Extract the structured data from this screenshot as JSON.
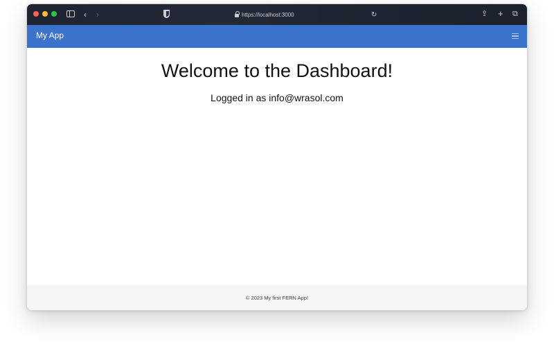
{
  "browser": {
    "url": "https://localhost:3000",
    "icons": [
      "sidebar-icon",
      "back-icon",
      "forward-icon",
      "shield-icon",
      "lock-icon",
      "reload-icon",
      "share-icon",
      "new-tab-icon",
      "tabs-overview-icon"
    ]
  },
  "navbar": {
    "brand": "My App",
    "menu_icon": "hamburger-menu-icon",
    "color": "#3b73cc"
  },
  "main": {
    "title": "Welcome to the Dashboard!",
    "logged_in_text": "Logged in as info@wrasol.com"
  },
  "footer": {
    "text": "© 2023 My first FERN App!"
  }
}
